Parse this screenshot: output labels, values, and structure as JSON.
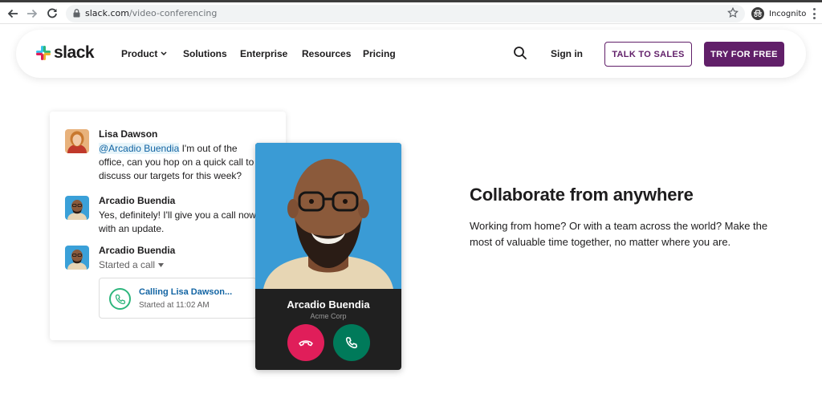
{
  "browser": {
    "url_host": "slack.com",
    "url_path": "/video-conferencing",
    "profile_label": "Incognito",
    "icons": [
      "back-arrow-icon",
      "forward-arrow-icon",
      "reload-icon",
      "lock-icon",
      "star-icon",
      "incognito-icon",
      "kebab-menu-icon"
    ]
  },
  "header": {
    "logo_text": "slack",
    "nav": [
      {
        "label": "Product",
        "has_dropdown": true
      },
      {
        "label": "Solutions"
      },
      {
        "label": "Enterprise"
      },
      {
        "label": "Resources"
      },
      {
        "label": "Pricing"
      }
    ],
    "sign_in_label": "Sign in",
    "talk_to_sales_label": "TALK TO SALES",
    "try_for_free_label": "TRY FOR FREE"
  },
  "chat": {
    "messages": [
      {
        "sender": "Lisa Dawson",
        "mention": "@Arcadio Buendia",
        "text": " I'm out of the office, can you hop on a quick call to discuss our targets for this week?"
      },
      {
        "sender": "Arcadio Buendia",
        "text": "Yes, definitely! I'll give you a call now with an update."
      },
      {
        "sender": "Arcadio Buendia",
        "subtext": "Started a call"
      }
    ],
    "call": {
      "title": "Calling Lisa Dawson...",
      "time": "Started at 11:02 AM"
    }
  },
  "video_call": {
    "name": "Arcadio Buendia",
    "org": "Acme Corp"
  },
  "hero": {
    "title": "Collaborate from anywhere",
    "description": "Working from home? Or with a team across the world? Make the most of valuable time together, no matter where you are."
  },
  "colors": {
    "brand_purple": "#611f69",
    "link_blue": "#1264a3",
    "decline_red": "#e01e5a",
    "accept_green": "#007a5a",
    "call_green": "#2eb67d"
  }
}
